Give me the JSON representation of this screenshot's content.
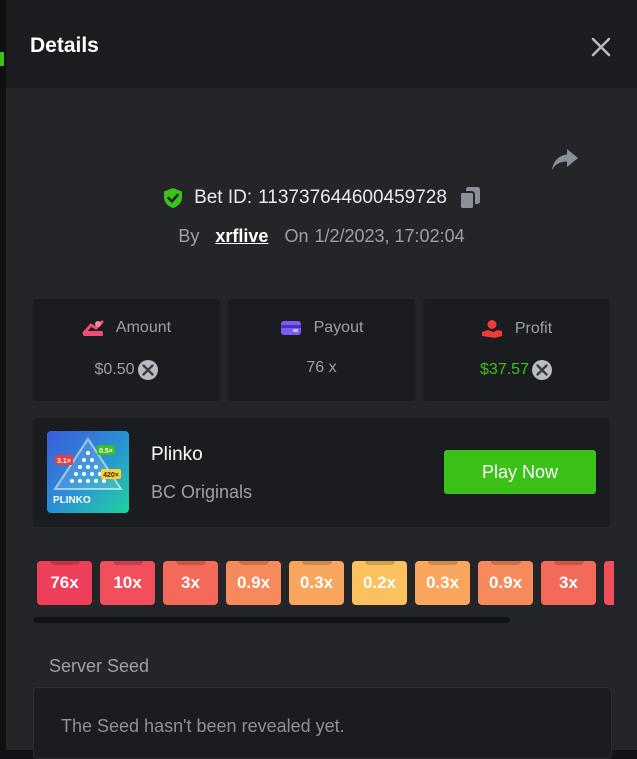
{
  "modal": {
    "title": "Details"
  },
  "bet": {
    "label": "Bet ID:",
    "id": "113737644600459728",
    "by_label": "By",
    "user": "xrflive",
    "on_label": "On",
    "date": "1/2/2023, 17:02:04"
  },
  "stats": [
    {
      "label": "Amount",
      "value": "$0.50",
      "icon": "amount-icon"
    },
    {
      "label": "Payout",
      "value": "76 x",
      "icon": "wallet-icon"
    },
    {
      "label": "Profit",
      "value": "$37.57",
      "icon": "profit-icon"
    }
  ],
  "game": {
    "name": "Plinko",
    "provider": "BC Originals",
    "play_label": "Play Now",
    "thumb_label": "PLINKO",
    "thumb_badges": [
      "3.1×",
      "0.5×",
      "420×"
    ]
  },
  "multipliers": [
    {
      "label": "76x",
      "color": "#ee3f5a"
    },
    {
      "label": "10x",
      "color": "#f04f5b"
    },
    {
      "label": "3x",
      "color": "#f46a5a"
    },
    {
      "label": "0.9x",
      "color": "#f68a5c"
    },
    {
      "label": "0.3x",
      "color": "#f8a65e"
    },
    {
      "label": "0.2x",
      "color": "#fbc15e"
    },
    {
      "label": "0.3x",
      "color": "#f8a65e"
    },
    {
      "label": "0.9x",
      "color": "#f68a5c"
    },
    {
      "label": "3x",
      "color": "#f46a5a"
    },
    {
      "label": "",
      "color": "#f04f5b"
    }
  ],
  "seed": {
    "title": "Server Seed",
    "text": "The Seed hasn't been revealed yet."
  },
  "colors": {
    "accent": "#3bc117",
    "background": "#232529",
    "card": "#1b1c1f"
  }
}
